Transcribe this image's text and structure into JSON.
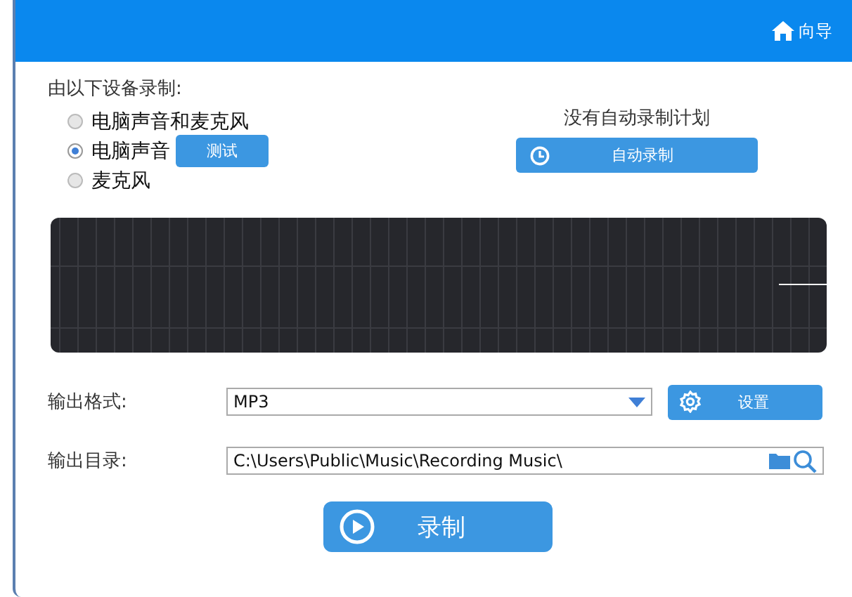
{
  "header": {
    "guide": "向导"
  },
  "source": {
    "label": "由以下设备录制:",
    "options": [
      {
        "label": "电脑声音和麦克风",
        "selected": false
      },
      {
        "label": "电脑声音",
        "selected": true,
        "button": "测试"
      },
      {
        "label": "麦克风",
        "selected": false
      }
    ]
  },
  "schedule": {
    "status": "没有自动录制计划",
    "button": "自动录制"
  },
  "output": {
    "format_label": "输出格式:",
    "format": "MP3",
    "settings_button": "设置",
    "folder_label": "输出目录:",
    "folder": "C:\\Users\\Public\\Music\\Recording Music\\"
  },
  "record_button": "录制"
}
